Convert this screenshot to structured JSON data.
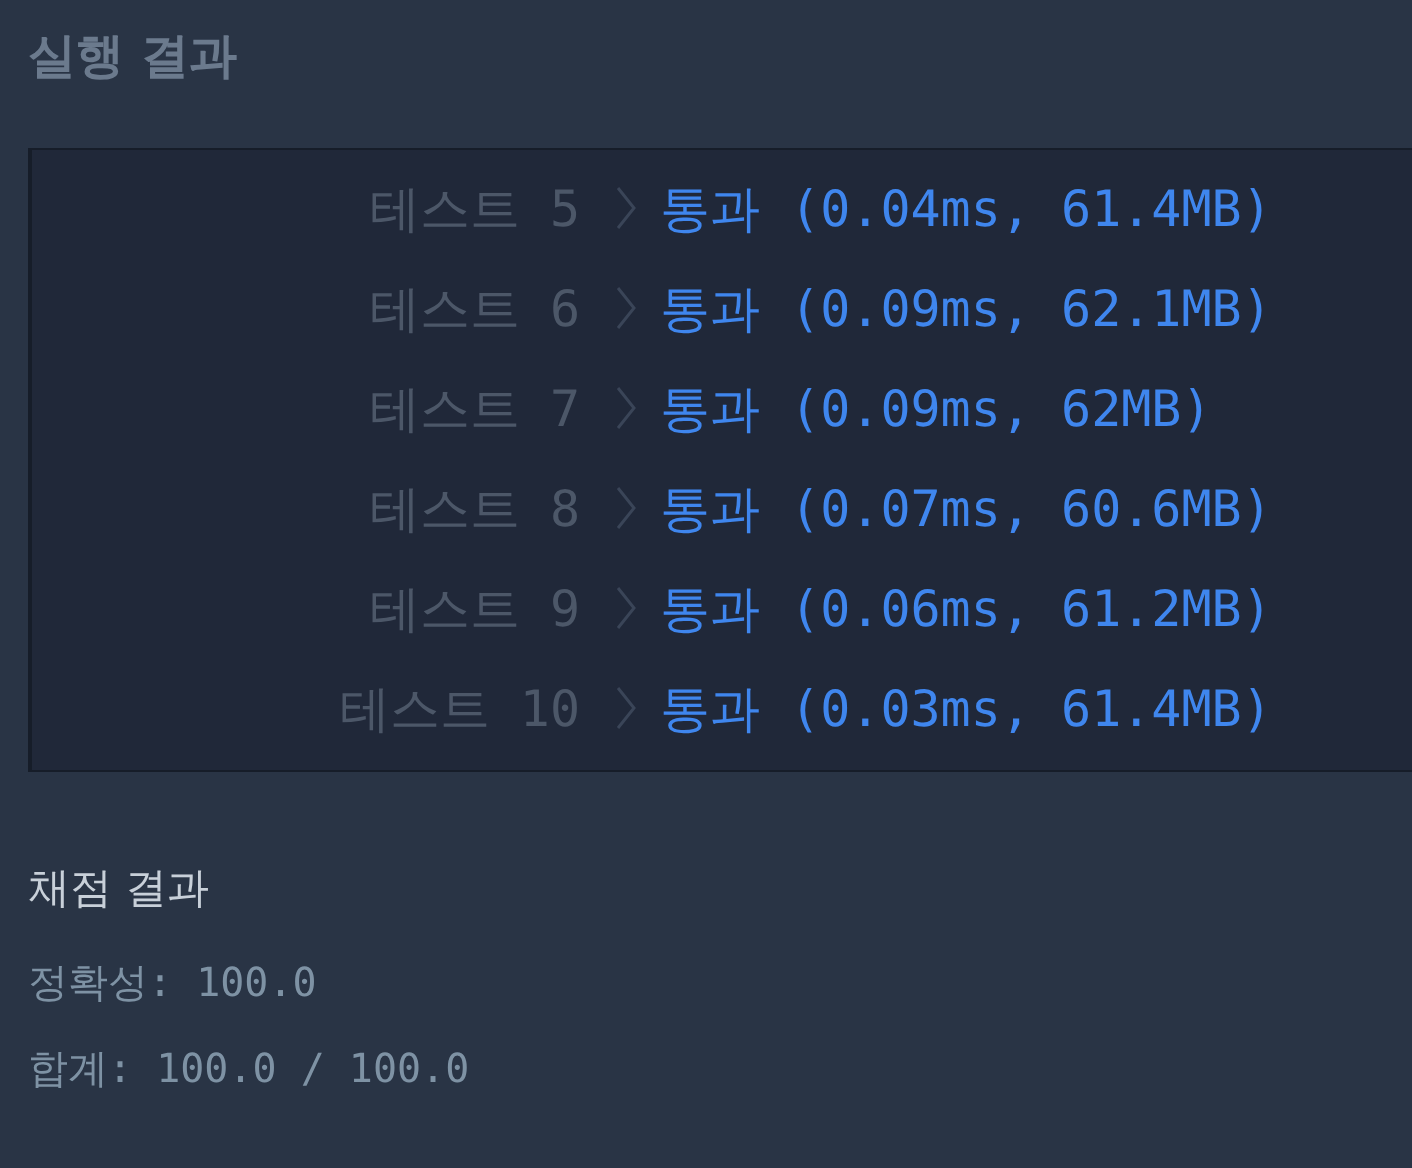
{
  "title": "실행 결과",
  "tests": [
    {
      "label": "테스트 5",
      "result": "통과 (0.04ms, 61.4MB)"
    },
    {
      "label": "테스트 6",
      "result": "통과 (0.09ms, 62.1MB)"
    },
    {
      "label": "테스트 7",
      "result": "통과 (0.09ms, 62MB)"
    },
    {
      "label": "테스트 8",
      "result": "통과 (0.07ms, 60.6MB)"
    },
    {
      "label": "테스트 9",
      "result": "통과 (0.06ms, 61.2MB)"
    },
    {
      "label": "테스트 10",
      "result": "통과 (0.03ms, 61.4MB)"
    }
  ],
  "grading": {
    "title": "채점 결과",
    "lines": [
      "정확성: 100.0",
      "합계: 100.0 / 100.0"
    ]
  }
}
